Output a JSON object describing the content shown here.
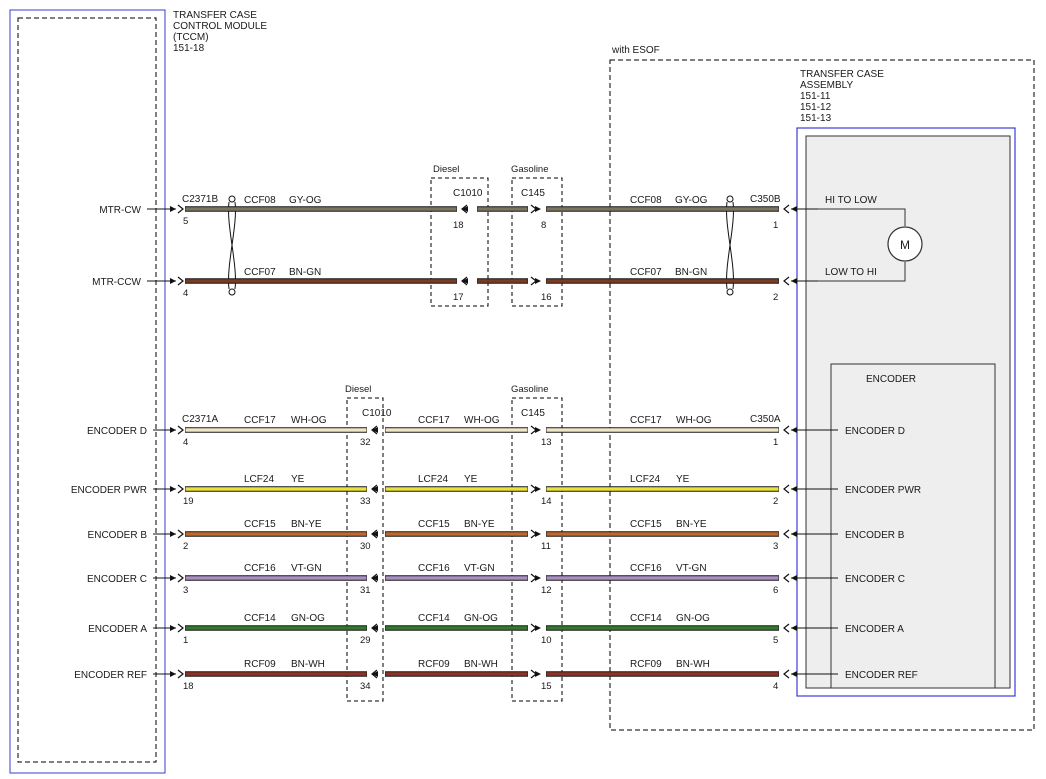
{
  "tccm": {
    "title_lines": [
      "TRANSFER CASE",
      "CONTROL MODULE",
      "(TCCM)",
      "151-18"
    ]
  },
  "esof_label": "with ESOF",
  "transfer_case": {
    "title_lines": [
      "TRANSFER CASE",
      "ASSEMBLY",
      "151-11",
      "151-12",
      "151-13"
    ],
    "motor_symbol": "M",
    "encoder_title": "ENCODER"
  },
  "inline_connectors": {
    "top_diesel": {
      "label": "Diesel",
      "name": "C1010"
    },
    "top_gasoline": {
      "label": "Gasoline",
      "name": "C145"
    },
    "bottom_diesel": {
      "label": "Diesel",
      "name": "C1010"
    },
    "bottom_gasoline": {
      "label": "Gasoline",
      "name": "C145"
    }
  },
  "module_connectors": {
    "motor_left": "C2371B",
    "motor_right": "C350B",
    "encoder_left": "C2371A",
    "encoder_right": "C350A"
  },
  "motor_circuits": [
    {
      "signal": "MTR-CW",
      "circuit": "CCF08",
      "color": "GY-OG",
      "hex": "#7a7460",
      "pin_left": "5",
      "pin_inline": "18",
      "pin_gas": "8",
      "pin_right": "1",
      "right_label": "HI TO LOW"
    },
    {
      "signal": "MTR-CCW",
      "circuit": "CCF07",
      "color": "BN-GN",
      "hex": "#7b3a22",
      "pin_left": "4",
      "pin_inline": "17",
      "pin_gas": "16",
      "pin_right": "2",
      "right_label": "LOW TO HI"
    }
  ],
  "encoder_circuits": [
    {
      "signal": "ENCODER D",
      "circuit": "CCF17",
      "color": "WH-OG",
      "hex": "#efe6c8",
      "pin_left": "4",
      "pin_inline": "32",
      "pin_gas": "13",
      "pin_right": "1",
      "right_label": "ENCODER D"
    },
    {
      "signal": "ENCODER PWR",
      "circuit": "LCF24",
      "color": "YE",
      "hex": "#e9e23a",
      "pin_left": "19",
      "pin_inline": "33",
      "pin_gas": "14",
      "pin_right": "2",
      "right_label": "ENCODER PWR"
    },
    {
      "signal": "ENCODER B",
      "circuit": "CCF15",
      "color": "BN-YE",
      "hex": "#c0672c",
      "pin_left": "2",
      "pin_inline": "30",
      "pin_gas": "11",
      "pin_right": "3",
      "right_label": "ENCODER B"
    },
    {
      "signal": "ENCODER C",
      "circuit": "CCF16",
      "color": "VT-GN",
      "hex": "#a98fc2",
      "pin_left": "3",
      "pin_inline": "31",
      "pin_gas": "12",
      "pin_right": "6",
      "right_label": "ENCODER C"
    },
    {
      "signal": "ENCODER A",
      "circuit": "CCF14",
      "color": "GN-OG",
      "hex": "#2f7a2c",
      "pin_left": "1",
      "pin_inline": "29",
      "pin_gas": "10",
      "pin_right": "5",
      "right_label": "ENCODER A"
    },
    {
      "signal": "ENCODER REF",
      "circuit": "RCF09",
      "color": "BN-WH",
      "hex": "#8c3328",
      "pin_left": "18",
      "pin_inline": "34",
      "pin_gas": "15",
      "pin_right": "4",
      "right_label": "ENCODER REF"
    }
  ]
}
